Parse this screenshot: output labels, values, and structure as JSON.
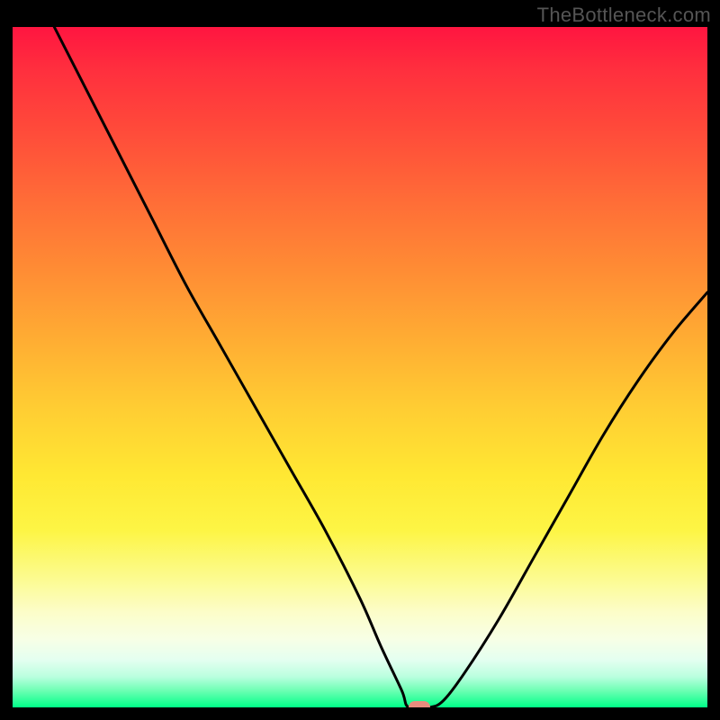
{
  "attribution": "TheBottleneck.com",
  "chart_data": {
    "type": "line",
    "title": "",
    "xlabel": "",
    "ylabel": "",
    "xlim": [
      0,
      100
    ],
    "ylim": [
      0,
      100
    ],
    "grid": false,
    "legend": false,
    "series": [
      {
        "name": "bottleneck-curve",
        "x": [
          6,
          10,
          15,
          20,
          25,
          30,
          35,
          40,
          45,
          50,
          53,
          56,
          57,
          60,
          62,
          65,
          70,
          75,
          80,
          85,
          90,
          95,
          100
        ],
        "y": [
          100,
          92,
          82,
          72,
          62,
          53,
          44,
          35,
          26,
          16,
          9,
          2.5,
          0,
          0,
          1,
          5,
          13,
          22,
          31,
          40,
          48,
          55,
          61
        ]
      }
    ],
    "marker": {
      "x": 58.5,
      "y": 0
    },
    "gradient_stops": [
      {
        "pos": 0,
        "color": "#ff1540"
      },
      {
        "pos": 50,
        "color": "#ffcd33"
      },
      {
        "pos": 80,
        "color": "#fcfb8f"
      },
      {
        "pos": 100,
        "color": "#00ff88"
      }
    ]
  }
}
